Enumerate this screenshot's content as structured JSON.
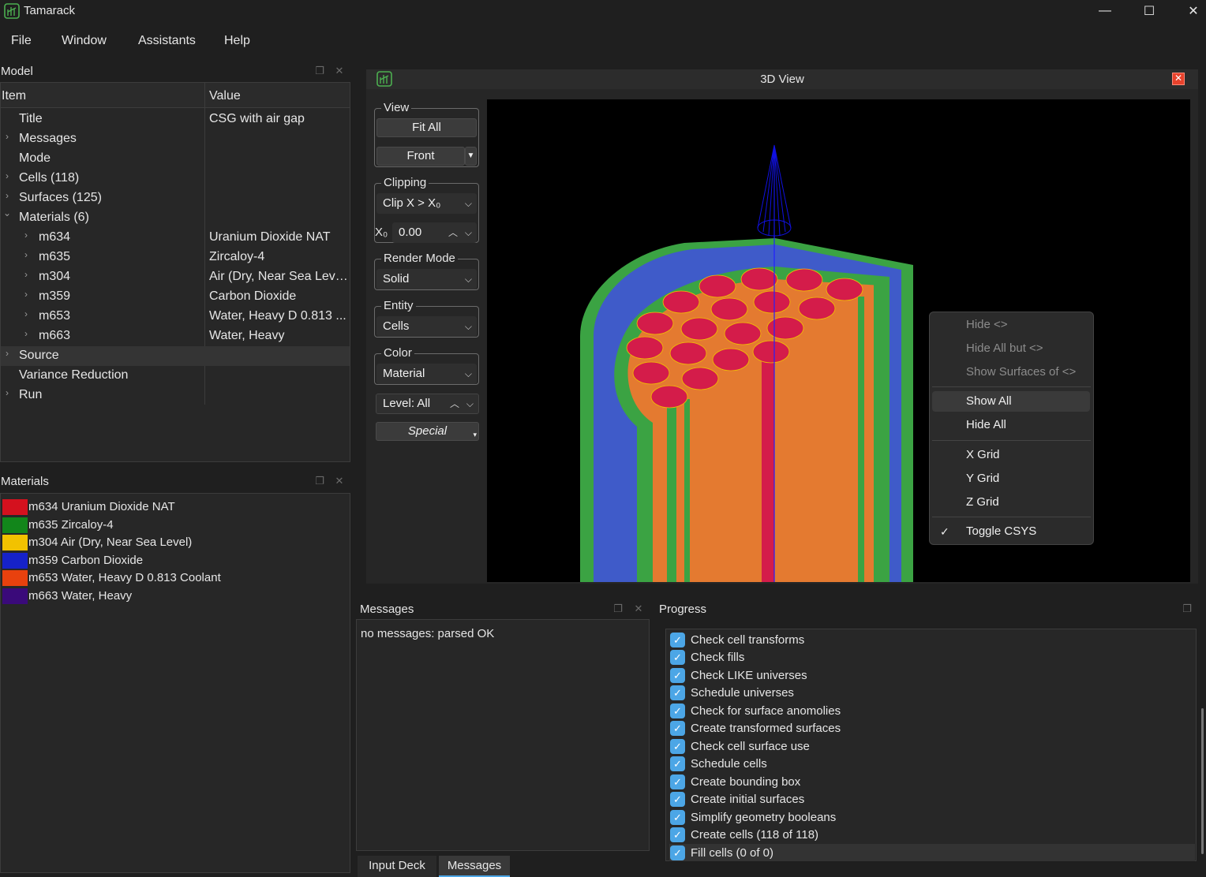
{
  "app": {
    "title": "Tamarack",
    "accent": "#4caf50"
  },
  "window_controls": {
    "minimize": "—",
    "maximize": "☐",
    "close": "✕"
  },
  "menu": [
    "File",
    "Window",
    "Assistants",
    "Help"
  ],
  "model_panel": {
    "title": "Model",
    "columns": [
      "Item",
      "Value"
    ],
    "rows": [
      {
        "item": "Title",
        "value": "CSG with air gap",
        "arrow": ""
      },
      {
        "item": "Messages",
        "value": "",
        "arrow": "›"
      },
      {
        "item": "Mode",
        "value": "",
        "arrow": ""
      },
      {
        "item": "Cells (118)",
        "value": "",
        "arrow": "›"
      },
      {
        "item": "Surfaces (125)",
        "value": "",
        "arrow": "›"
      },
      {
        "item": "Materials (6)",
        "value": "",
        "arrow": "⌄"
      },
      {
        "item": "m634",
        "value": "Uranium Dioxide NAT",
        "arrow": "›"
      },
      {
        "item": "m635",
        "value": "Zircaloy-4",
        "arrow": "›"
      },
      {
        "item": "m304",
        "value": "Air (Dry, Near Sea Level)",
        "arrow": "›"
      },
      {
        "item": "m359",
        "value": "Carbon Dioxide",
        "arrow": "›"
      },
      {
        "item": "m653",
        "value": "Water, Heavy D 0.813 ...",
        "arrow": "›"
      },
      {
        "item": "m663",
        "value": "Water, Heavy",
        "arrow": "›"
      },
      {
        "item": "Source",
        "value": "",
        "arrow": "›"
      },
      {
        "item": "Variance Reduction",
        "value": "",
        "arrow": ""
      },
      {
        "item": "Run",
        "value": "",
        "arrow": "›"
      }
    ]
  },
  "materials_panel": {
    "title": "Materials",
    "items": [
      {
        "label": "m634 Uranium Dioxide NAT",
        "color": "#d4111e"
      },
      {
        "label": "m635 Zircaloy-4",
        "color": "#12861b"
      },
      {
        "label": "m304 Air (Dry, Near Sea Level)",
        "color": "#f2c200"
      },
      {
        "label": "m359 Carbon Dioxide",
        "color": "#1622c9"
      },
      {
        "label": "m653 Water, Heavy D 0.813 Coolant",
        "color": "#e8410e"
      },
      {
        "label": "m663 Water, Heavy",
        "color": "#3a0a7a"
      }
    ]
  },
  "view3d": {
    "title": "3D View",
    "view_group": {
      "label": "View",
      "fit_all": "Fit All",
      "direction": "Front"
    },
    "clipping_group": {
      "label": "Clipping",
      "mode": "Clip X > X₀",
      "x0_label": "X₀",
      "x0_value": "0.00"
    },
    "render_group": {
      "label": "Render Mode",
      "value": "Solid"
    },
    "entity_group": {
      "label": "Entity",
      "value": "Cells"
    },
    "color_group": {
      "label": "Color",
      "value": "Material"
    },
    "level": "Level: All",
    "special": "Special"
  },
  "context_menu": {
    "items": [
      {
        "label": "Hide <>",
        "enabled": false
      },
      {
        "label": "Hide All but <>",
        "enabled": false
      },
      {
        "label": "Show Surfaces of <>",
        "enabled": false
      },
      {
        "label": "Show All",
        "enabled": true
      },
      {
        "label": "Hide All",
        "enabled": true
      },
      {
        "label": "X Grid",
        "enabled": true
      },
      {
        "label": "Y Grid",
        "enabled": true
      },
      {
        "label": "Z Grid",
        "enabled": true
      },
      {
        "label": "Toggle CSYS",
        "enabled": true,
        "checked": true
      }
    ],
    "check_mark": "✓"
  },
  "messages_panel": {
    "title": "Messages",
    "text": "no messages: parsed OK",
    "tabs": [
      "Input Deck",
      "Messages"
    ]
  },
  "progress_panel": {
    "title": "Progress",
    "items": [
      "Check cell transforms",
      "Check fills",
      "Check LIKE universes",
      "Schedule universes",
      "Check for surface anomolies",
      "Create transformed surfaces",
      "Check cell surface use",
      "Schedule cells",
      "Create bounding box",
      "Create initial surfaces",
      "Simplify geometry booleans",
      "Create cells (118 of 118)",
      "Fill cells (0 of 0)"
    ]
  }
}
